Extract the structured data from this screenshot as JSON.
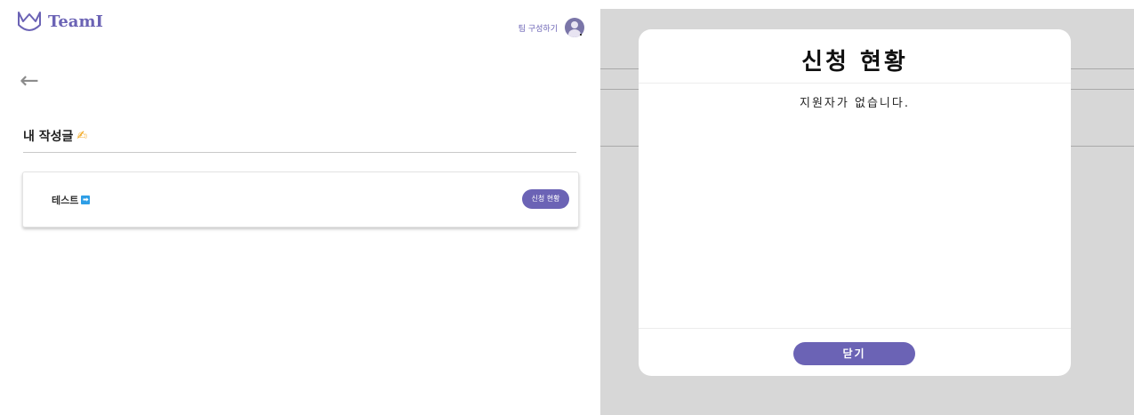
{
  "header": {
    "logo_text": "TeamI",
    "team_link_label": "팀 구성하기",
    "avatar_icon": "user-avatar-icon"
  },
  "main": {
    "back_icon": "back-arrow-icon",
    "section_title": "내 작성글",
    "section_icon": "pencil-icon",
    "posts": [
      {
        "title": "테스트",
        "badge": "➡",
        "status_button_label": "신청 현황"
      }
    ]
  },
  "modal": {
    "title": "신청 현황",
    "message": "지원자가 없습니다.",
    "close_button_label": "닫기"
  },
  "colors": {
    "accent": "#6b63b5",
    "overlay": "#d7d7d7",
    "pencil": "#f2a51a",
    "badge": "#2e9ee6"
  }
}
